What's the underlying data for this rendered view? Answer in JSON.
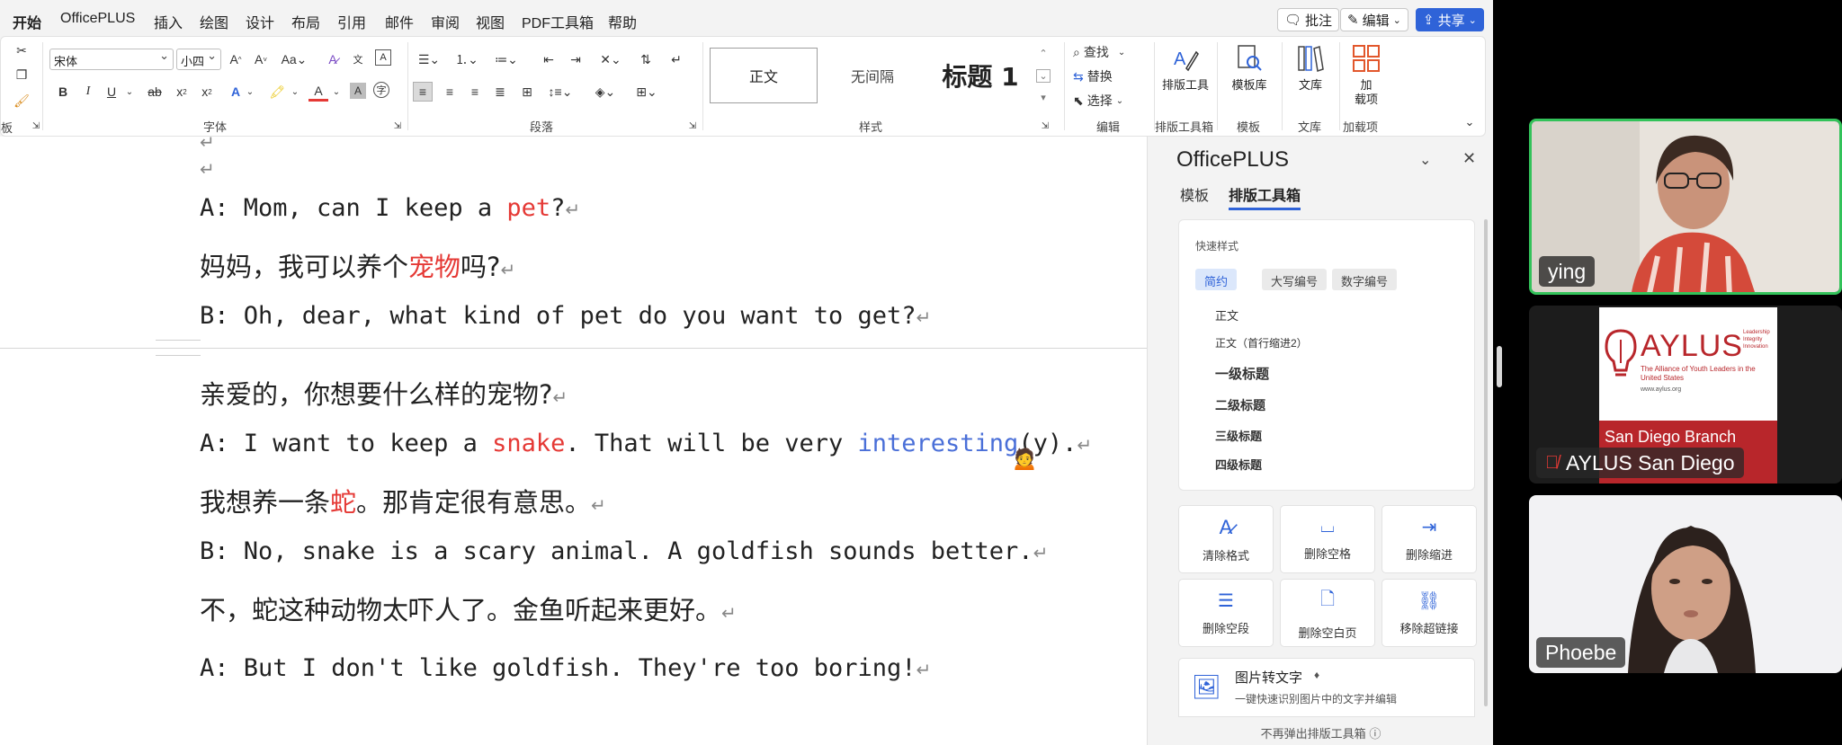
{
  "menubar": {
    "items": [
      "开始",
      "OfficePLUS",
      "插入",
      "绘图",
      "设计",
      "布局",
      "引用",
      "邮件",
      "审阅",
      "视图",
      "PDF工具箱",
      "帮助"
    ],
    "comment_btn": "批注",
    "edit_btn": "编辑",
    "share_btn": "共享"
  },
  "ribbon": {
    "font_name": "宋体",
    "font_size": "小四",
    "group_font": "字体",
    "group_paragraph": "段落",
    "group_styles": "样式",
    "group_edit": "编辑",
    "group_layout_tools": "排版工具箱",
    "group_template": "模板",
    "group_library": "文库",
    "group_addins": "加载项",
    "clipboard_partial": "板",
    "styles": [
      "正文",
      "无间隔",
      "标题 1"
    ],
    "find": "查找",
    "replace": "替换",
    "select": "选择",
    "btn_layout": "排版工具",
    "btn_template": "模板库",
    "btn_library": "文库",
    "btn_addins": "加\n载项"
  },
  "document": {
    "lines": [
      {
        "type": "en",
        "parts": [
          {
            "t": "A: Mom, can I keep a "
          },
          {
            "t": "pet",
            "c": "red"
          },
          {
            "t": "?"
          }
        ]
      },
      {
        "type": "cn",
        "parts": [
          {
            "t": "妈妈，我可以养个"
          },
          {
            "t": "宠物",
            "c": "red"
          },
          {
            "t": "吗?"
          }
        ]
      },
      {
        "type": "en",
        "parts": [
          {
            "t": "B: Oh, dear, what kind of pet do you want to get?"
          }
        ]
      },
      {
        "type": "cn",
        "parts": [
          {
            "t": "亲爱的，你想要什么样的宠物?"
          }
        ]
      },
      {
        "type": "en",
        "parts": [
          {
            "t": "A: I want to keep a "
          },
          {
            "t": "snake",
            "c": "red"
          },
          {
            "t": ". That will be very "
          },
          {
            "t": "interesting",
            "c": "blue"
          },
          {
            "t": "(y)."
          }
        ]
      },
      {
        "type": "cn",
        "parts": [
          {
            "t": "我想养一条"
          },
          {
            "t": "蛇",
            "c": "red"
          },
          {
            "t": "。那肯定很有意思。"
          }
        ]
      },
      {
        "type": "en",
        "parts": [
          {
            "t": "B: No, snake is a scary animal. A goldfish sounds better."
          }
        ]
      },
      {
        "type": "cn",
        "parts": [
          {
            "t": "不，蛇这种动物太吓人了。金鱼听起来更好。"
          }
        ]
      },
      {
        "type": "en",
        "parts": [
          {
            "t": "A: But I don't like goldfish. They're too boring!"
          }
        ]
      }
    ]
  },
  "pane": {
    "title": "OfficePLUS",
    "tab_template": "模板",
    "tab_layout": "排版工具箱",
    "quick_styles_label": "快速样式",
    "chips": [
      "简约",
      "大写编号",
      "数字编号"
    ],
    "style_list": [
      "正文",
      "正文（首行缩进2）",
      "一级标题",
      "二级标题",
      "三级标题",
      "四级标题"
    ],
    "tools": [
      "清除格式",
      "删除空格",
      "删除缩进",
      "删除空段",
      "删除空白页",
      "移除超链接"
    ],
    "ocr_title": "图片转文字",
    "ocr_desc": "一键快速识别图片中的文字并编辑",
    "footer": "不再弹出排版工具箱"
  },
  "participants": [
    {
      "name": "ying"
    },
    {
      "name": "AYLUS San Diego",
      "logo_title": "AYLUS",
      "logo_sub": "The Alliance of Youth Leaders in the United States",
      "logo_url": "www.aylus.org",
      "logo_tag": "Leadership Integrity Innovation",
      "logo_branch": "San Diego Branch"
    },
    {
      "name": "Phoebe"
    }
  ],
  "colors": {
    "accent": "#2f63d8",
    "red_text": "#e53935",
    "blue_text": "#4a6fd8",
    "speaker_border": "#33c25a",
    "aylus_red": "#b8262b"
  }
}
